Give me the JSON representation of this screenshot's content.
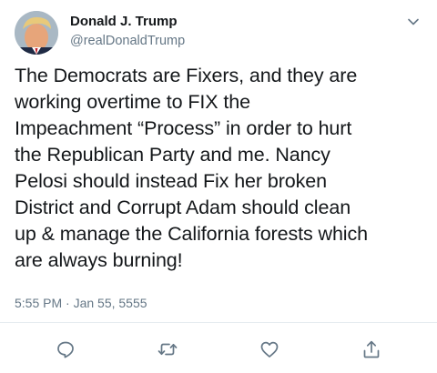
{
  "tweet": {
    "display_name": "Donald J. Trump",
    "handle": "@realDonaldTrump",
    "body_lines": [
      "The Democrats are Fixers, and they are",
      "working overtime to FIX the",
      "Impeachment “Process” in order to hurt",
      "the Republican Party and me. Nancy",
      "Pelosi should instead Fix her broken",
      "District and Corrupt Adam should clean",
      "up & manage the California forests which",
      "are always burning!"
    ],
    "timestamp": "5:55 PM · Jan 55, 5555"
  },
  "icons": {
    "menu": "chevron-down-icon",
    "reply": "reply-icon",
    "retweet": "retweet-icon",
    "like": "heart-icon",
    "share": "share-icon"
  },
  "colors": {
    "text_primary": "#14171a",
    "text_secondary": "#657786",
    "icon": "#657786",
    "divider": "#e6ecf0",
    "background": "#ffffff"
  }
}
